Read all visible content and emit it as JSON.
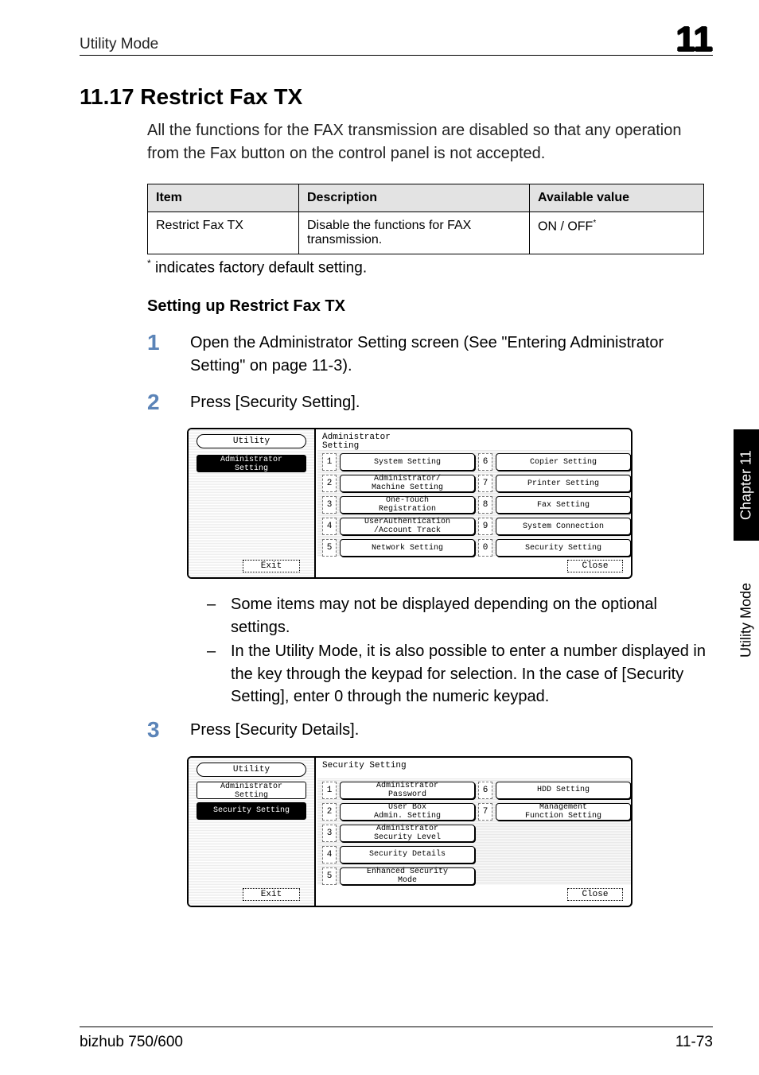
{
  "header": {
    "section": "Utility Mode",
    "chapter_num": "11"
  },
  "title": "11.17  Restrict Fax TX",
  "intro": "All the functions for the FAX transmission are disabled so that any operation from the Fax button on the control panel is not accepted.",
  "table": {
    "headers": [
      "Item",
      "Description",
      "Available value"
    ],
    "rows": [
      {
        "item": "Restrict Fax TX",
        "desc": "Disable the functions for FAX transmission.",
        "avail": "ON / OFF",
        "avail_mark": "*"
      }
    ]
  },
  "footnote": {
    "mark": "*",
    "text": " indicates factory default setting."
  },
  "subhead": "Setting up Restrict Fax TX",
  "steps": [
    {
      "n": "1",
      "text": "Open the Administrator Setting screen (See \"Entering Administrator Setting\" on page 11-3)."
    },
    {
      "n": "2",
      "text": "Press [Security Setting]."
    },
    {
      "n": "3",
      "text": "Press [Security Details]."
    }
  ],
  "bullets": [
    "Some items may not be displayed depending on the optional settings.",
    "In the Utility Mode, it is also possible to enter a number displayed in the key through the keypad for selection. In the case of [Security Setting], enter 0 through the numeric keypad."
  ],
  "ss1": {
    "left_tab": "Utility",
    "left_items": [
      {
        "label": "Administrator\nSetting",
        "bg": "black"
      }
    ],
    "exit": "Exit",
    "title": "Administrator\nSetting",
    "menu": [
      {
        "n": "1",
        "label": "System Setting"
      },
      {
        "n": "6",
        "label": "Copier Setting"
      },
      {
        "n": "2",
        "label": "Administrator/\nMachine Setting"
      },
      {
        "n": "7",
        "label": "Printer Setting"
      },
      {
        "n": "3",
        "label": "One-Touch\nRegistration"
      },
      {
        "n": "8",
        "label": "Fax Setting"
      },
      {
        "n": "4",
        "label": "UserAuthentication\n/Account Track"
      },
      {
        "n": "9",
        "label": "System Connection"
      },
      {
        "n": "5",
        "label": "Network Setting"
      },
      {
        "n": "0",
        "label": "Security Setting"
      }
    ],
    "close": "Close"
  },
  "ss2": {
    "left_tab": "Utility",
    "left_items": [
      {
        "label": "Administrator\nSetting",
        "bg": "white"
      },
      {
        "label": "Security Setting",
        "bg": "black"
      }
    ],
    "exit": "Exit",
    "title": "Security Setting",
    "menu": [
      {
        "n": "1",
        "label": "Administrator\nPassword"
      },
      {
        "n": "6",
        "label": "HDD Setting"
      },
      {
        "n": "2",
        "label": "User Box\nAdmin. Setting"
      },
      {
        "n": "7",
        "label": "Management\nFunction Setting"
      },
      {
        "n": "3",
        "label": "Administrator\nSecurity Level"
      },
      {
        "n": "",
        "label": ""
      },
      {
        "n": "4",
        "label": "Security Details"
      },
      {
        "n": "",
        "label": ""
      },
      {
        "n": "5",
        "label": "Enhanced Security\nMode"
      },
      {
        "n": "",
        "label": ""
      }
    ],
    "close": "Close"
  },
  "side": {
    "black": "Chapter 11",
    "gray": "Utility Mode"
  },
  "footer": {
    "left": "bizhub 750/600",
    "right": "11-73"
  }
}
